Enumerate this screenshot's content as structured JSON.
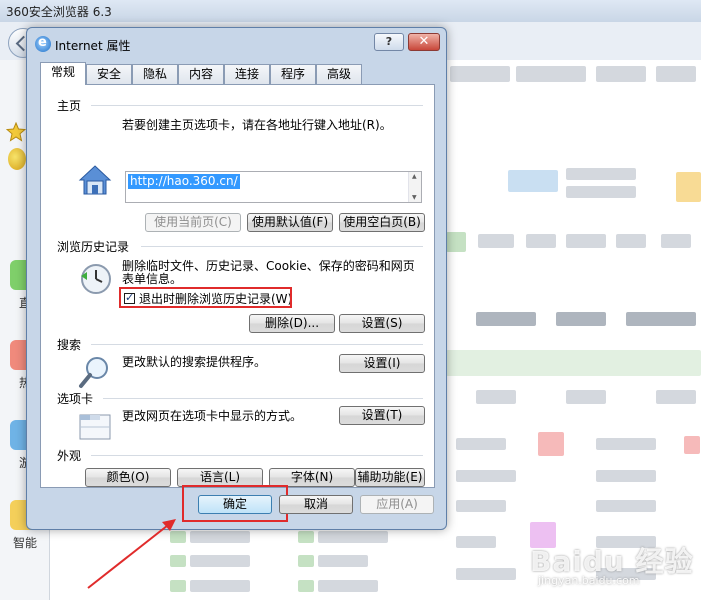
{
  "browser": {
    "title": "360安全浏览器 6.3",
    "rail": [
      "直",
      "热",
      "游",
      "智能"
    ]
  },
  "dialog": {
    "title": "Internet 属性",
    "help": "?",
    "close": "✕",
    "tabs": [
      "常规",
      "安全",
      "隐私",
      "内容",
      "连接",
      "程序",
      "高级"
    ],
    "homepage": {
      "label": "主页",
      "desc": "若要创建主页选项卡，请在各地址行键入地址(R)。",
      "url": "http://hao.360.cn/",
      "btn_current": "使用当前页(C)",
      "btn_default": "使用默认值(F)",
      "btn_blank": "使用空白页(B)"
    },
    "history": {
      "label": "浏览历史记录",
      "desc_line1": "删除临时文件、历史记录、Cookie、保存的密码和网页",
      "desc_line2": "表单信息。",
      "checkbox_label": "退出时删除浏览历史记录(W)",
      "checkbox_checked": true,
      "btn_delete": "删除(D)...",
      "btn_settings": "设置(S)"
    },
    "search": {
      "label": "搜索",
      "desc": "更改默认的搜索提供程序。",
      "btn_settings": "设置(I)"
    },
    "tabsection": {
      "label": "选项卡",
      "desc": "更改网页在选项卡中显示的方式。",
      "btn_settings": "设置(T)"
    },
    "appearance": {
      "label": "外观",
      "btn_colors": "颜色(O)",
      "btn_languages": "语言(L)",
      "btn_fonts": "字体(N)",
      "btn_accessibility": "辅助功能(E)"
    },
    "footer": {
      "ok": "确定",
      "cancel": "取消",
      "apply": "应用(A)"
    }
  },
  "watermark": {
    "text": "Baidu 经验",
    "url": "jingyan.baidu.com"
  },
  "colors": {
    "highlight_red": "#e02b2b",
    "selection_blue": "#3399ff"
  }
}
